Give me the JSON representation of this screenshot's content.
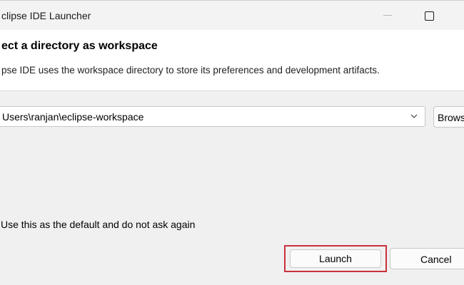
{
  "window": {
    "title": "clipse IDE Launcher"
  },
  "header": {
    "title": "ect a directory as workspace",
    "description": "pse IDE uses the workspace directory to store its preferences and development artifacts."
  },
  "workspace": {
    "path_value": "Users\\ranjan\\eclipse-workspace",
    "dropdown_icon": "chevron-down-icon",
    "browse_label": "Brows"
  },
  "options": {
    "default_checkbox_label": "Use this as the default and do not ask again"
  },
  "buttons": {
    "launch_label": "Launch",
    "cancel_label": "Cancel"
  },
  "colors": {
    "highlight_border": "#c8313b",
    "header_bg": "#ffffff",
    "dialog_bg": "#f0f0f0"
  }
}
